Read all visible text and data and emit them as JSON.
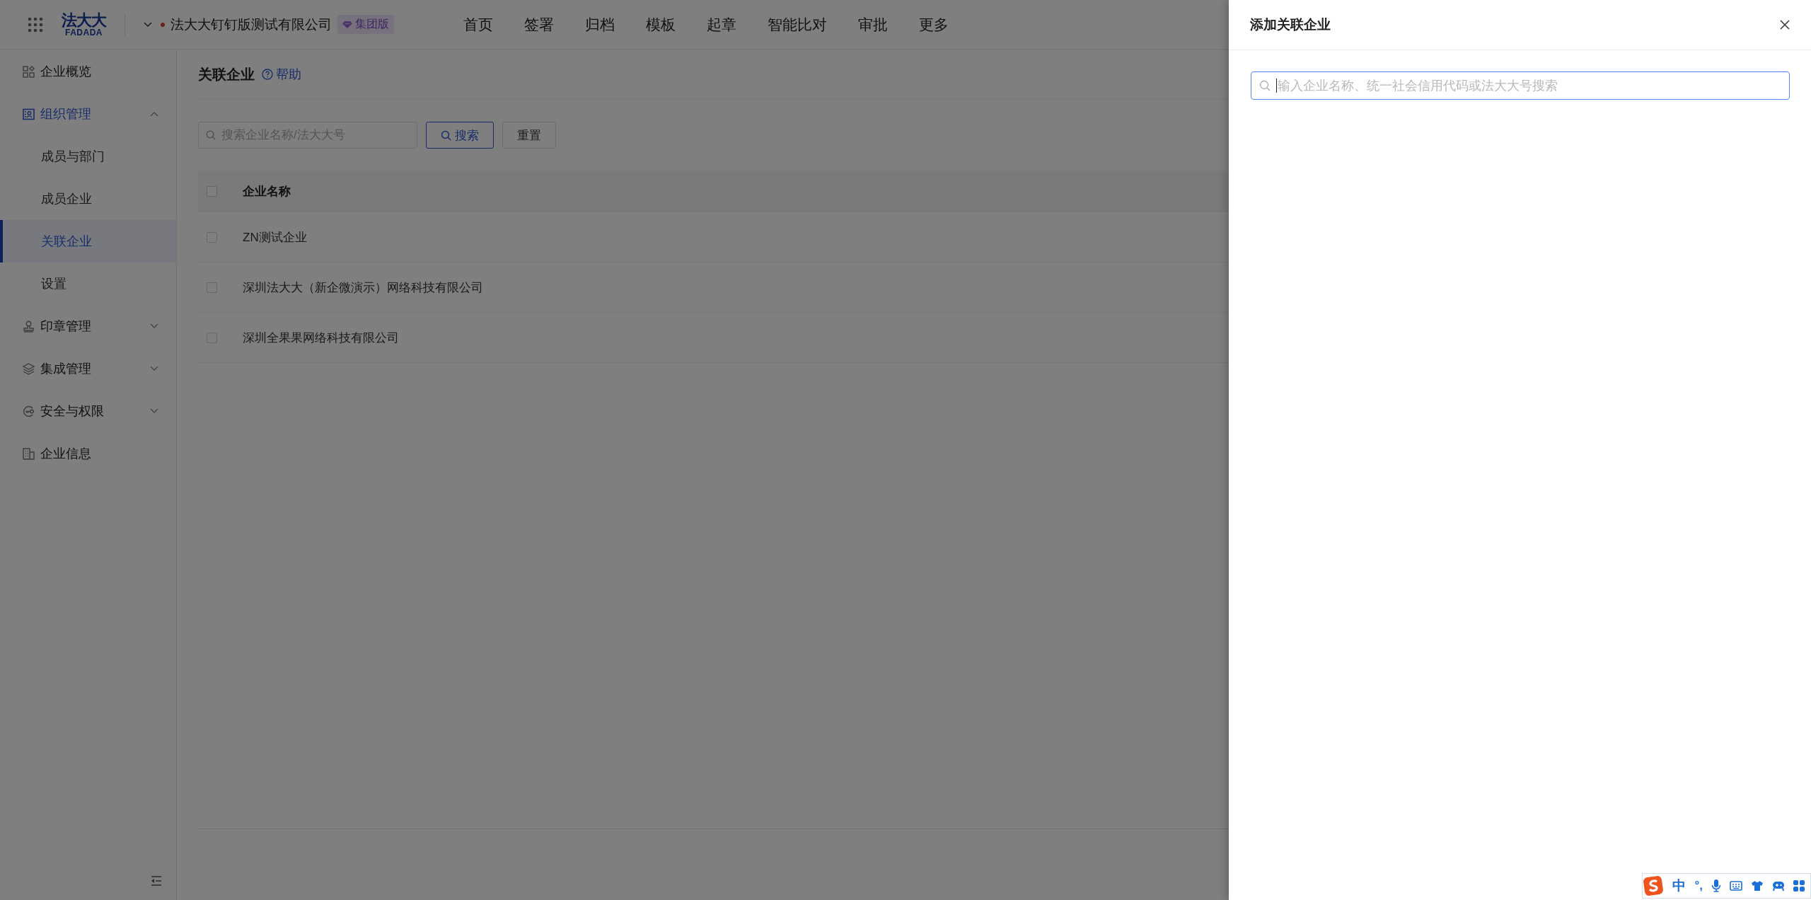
{
  "top_bar": {
    "logo": {
      "name": "法大大",
      "latin": "FADADA"
    },
    "company": {
      "name": "法大大钉钉版测试有限公司",
      "badge": "集团版"
    },
    "nav": [
      "首页",
      "签署",
      "归档",
      "模板",
      "起章",
      "智能比对",
      "审批",
      "更多"
    ]
  },
  "sidebar": {
    "items": [
      {
        "label": "企业概览",
        "selected": false
      },
      {
        "label": "组织管理",
        "selected": false,
        "expanded": true,
        "children": [
          {
            "label": "成员与部门",
            "selected": false
          },
          {
            "label": "成员企业",
            "selected": false
          },
          {
            "label": "关联企业",
            "selected": true
          },
          {
            "label": "设置",
            "selected": false
          }
        ]
      },
      {
        "label": "印章管理",
        "selected": false,
        "expanded": false
      },
      {
        "label": "集成管理",
        "selected": false,
        "expanded": false
      },
      {
        "label": "安全与权限",
        "selected": false,
        "expanded": false
      },
      {
        "label": "企业信息",
        "selected": false
      }
    ]
  },
  "page": {
    "title": "关联企业",
    "help": "帮助",
    "search": {
      "placeholder": "搜索企业名称/法大大号"
    },
    "buttons": [
      {
        "label": "搜索",
        "kind": "primary"
      },
      {
        "label": "重置",
        "kind": "default"
      }
    ],
    "table": {
      "select_all_checked": false,
      "columns": [
        "企业名称"
      ],
      "rows": [
        {
          "name": "ZN测试企业",
          "checked": false
        },
        {
          "name": "深圳法大大（新企微演示）网络科技有限公司",
          "checked": false
        },
        {
          "name": "深圳全果果网络科技有限公司",
          "checked": false
        }
      ]
    }
  },
  "drawer": {
    "title": "添加关联企业",
    "search": {
      "placeholder": "输入企业名称、统一社会信用代码或法大大号搜索",
      "focused": true
    }
  },
  "ime_toolbar": {
    "mode": "中",
    "punctuation": "°,"
  }
}
